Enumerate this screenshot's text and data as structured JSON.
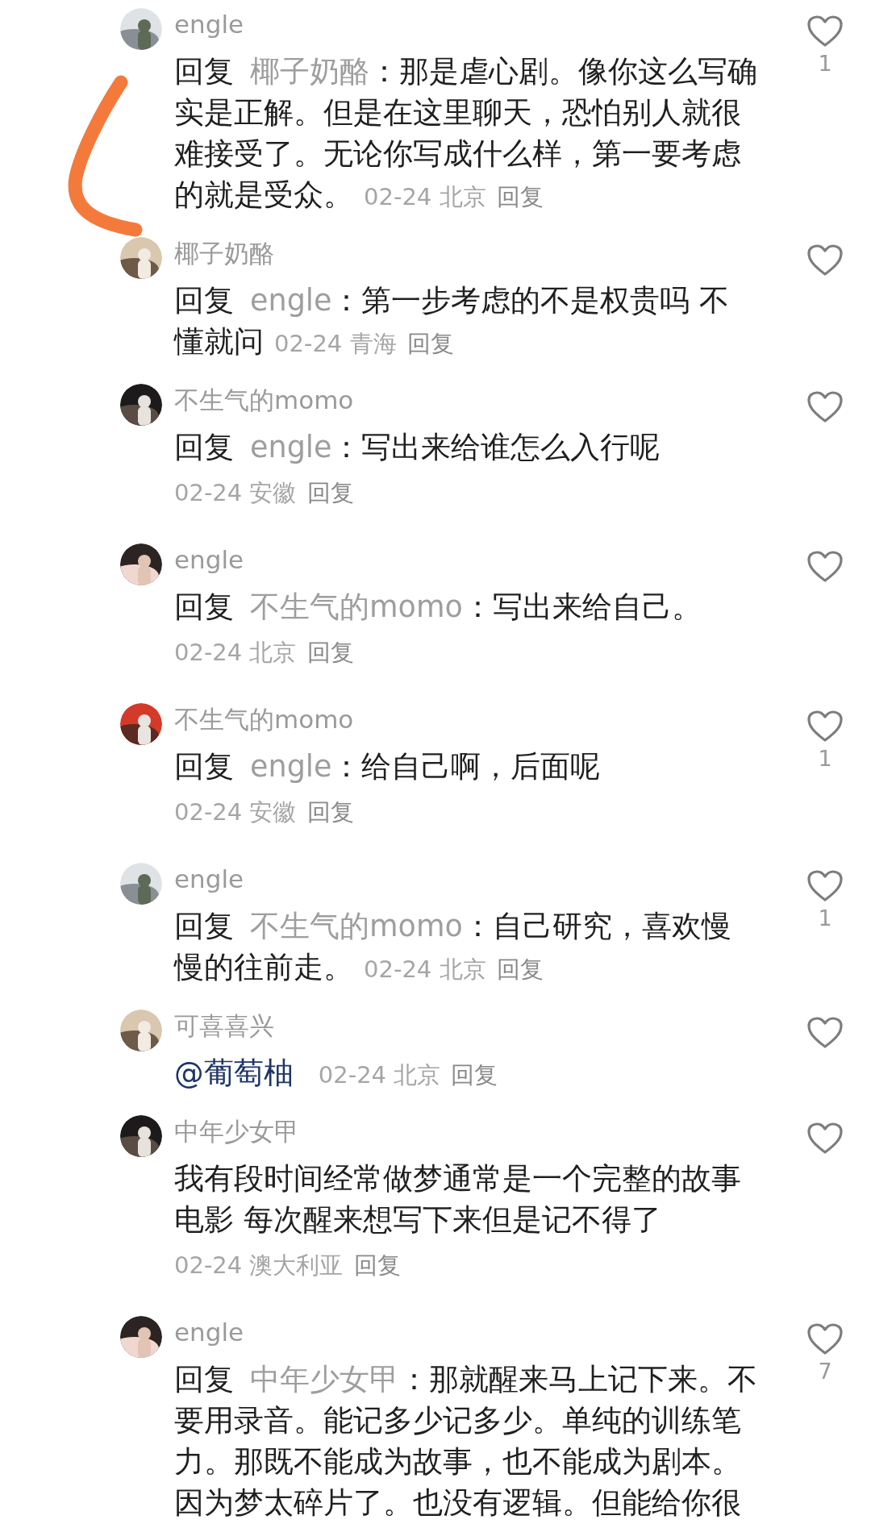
{
  "comments": [
    {
      "user": "engle",
      "reply_prefix": "回复",
      "reply_to": "椰子奶酪",
      "reply_colon": "：",
      "text": "那是虐心剧。像你这么写确实是正解。但是在这里聊天，恐怕别人就很难接受了。无论你写成什么样，第一要考虑的就是受众。",
      "meta": "02-24 北京",
      "reply_link": "回复",
      "meta_own_line": false,
      "likes": "1"
    },
    {
      "user": "椰子奶酪",
      "reply_prefix": "回复",
      "reply_to": "engle",
      "reply_colon": "：",
      "text": "第一步考虑的不是权贵吗 不懂就问",
      "meta": "02-24 青海",
      "reply_link": "回复",
      "meta_own_line": false
    },
    {
      "user": "不生气的momo",
      "reply_prefix": "回复",
      "reply_to": "engle",
      "reply_colon": "：",
      "text": "写出来给谁怎么入行呢",
      "meta": "02-24 安徽",
      "reply_link": "回复",
      "meta_own_line": true
    },
    {
      "user": "engle",
      "reply_prefix": "回复",
      "reply_to": "不生气的momo",
      "reply_colon": "：",
      "text": "写出来给自己。",
      "meta": "02-24 北京",
      "reply_link": "回复",
      "meta_own_line": true
    },
    {
      "user": "不生气的momo",
      "reply_prefix": "回复",
      "reply_to": "engle",
      "reply_colon": "：",
      "text": "给自己啊，后面呢",
      "meta": "02-24 安徽",
      "reply_link": "回复",
      "meta_own_line": true,
      "likes": "1"
    },
    {
      "user": "engle",
      "reply_prefix": "回复",
      "reply_to": "不生气的momo",
      "reply_colon": "：",
      "text": "自己研究，喜欢慢慢的往前走。",
      "meta": "02-24 北京",
      "reply_link": "回复",
      "meta_own_line": false,
      "likes": "1"
    },
    {
      "user": "可喜喜兴",
      "mention": "@葡萄柚",
      "meta": "02-24 北京",
      "reply_link": "回复",
      "meta_own_line": false
    },
    {
      "user": "中年少女甲",
      "text": "我有段时间经常做梦通常是一个完整的故事电影 每次醒来想写下来但是记不得了",
      "meta": "02-24 澳大利亚",
      "reply_link": "回复",
      "meta_own_line": true
    },
    {
      "user": "engle",
      "reply_prefix": "回复",
      "reply_to": "中年少女甲",
      "reply_colon": "：",
      "text": "那就醒来马上记下来。不要用录音。能记多少记多少。单纯的训练笔力。那既不能成为故事，也不能成为剧本。因为梦太碎片了。也没有逻辑。但能给你很",
      "likes": "7"
    }
  ]
}
